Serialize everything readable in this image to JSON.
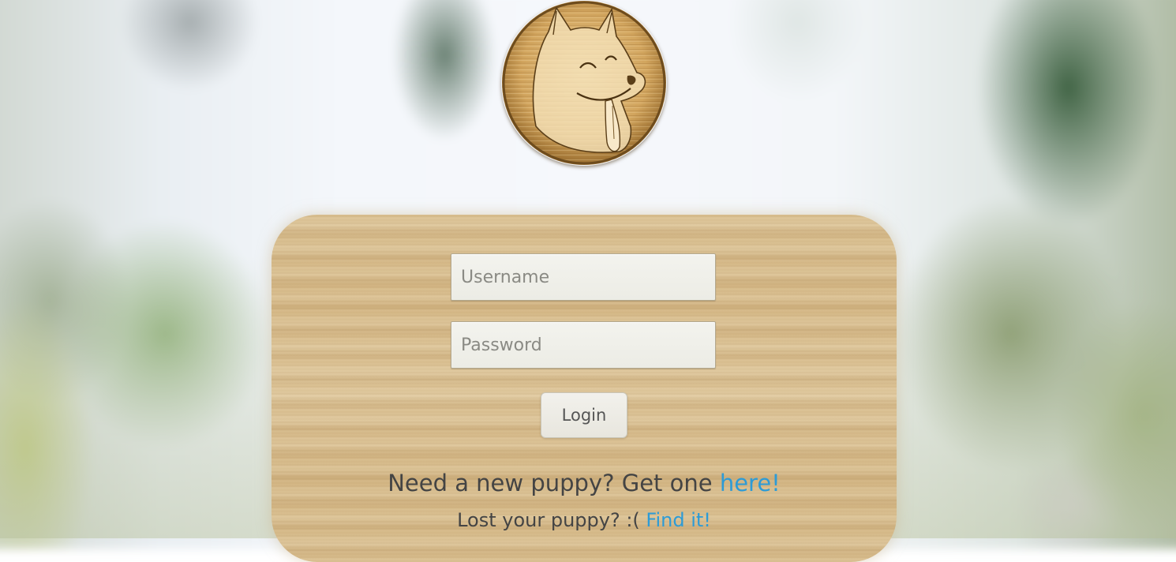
{
  "logo": {
    "icon": "wooden-dog-coin-logo"
  },
  "login_form": {
    "username_placeholder": "Username",
    "password_placeholder": "Password",
    "login_label": "Login"
  },
  "signup": {
    "text": "Need a new puppy? Get one",
    "link_label": "here!"
  },
  "recover": {
    "text": "Lost your puppy? :(",
    "link_label": "Find it!"
  },
  "colors": {
    "link": "#2d9bd6",
    "wood": "#d9bf90",
    "text": "#444444"
  }
}
